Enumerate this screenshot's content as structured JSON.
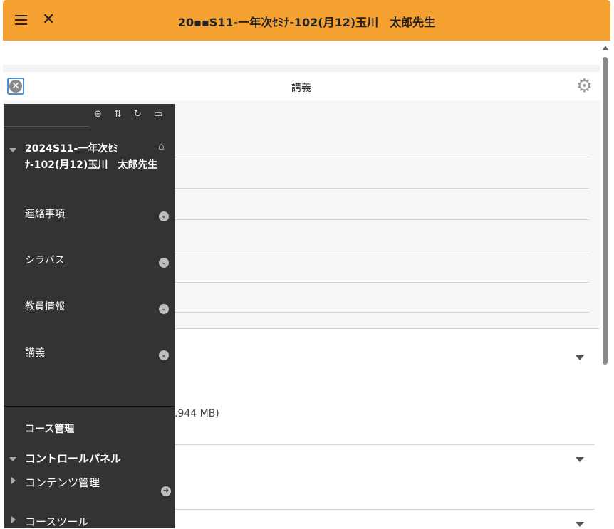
{
  "header": {
    "course_title": "20▪▪S11-一年次ｾﾐﾅ-102(月12)玉川　太郎先生",
    "menu_icon": "hamburger-icon",
    "close_icon": "close-icon",
    "color": "#f4a132"
  },
  "subbar": {
    "title": "講義",
    "close_icon": "close-circle-icon",
    "settings_icon": "gear-icon"
  },
  "content": {
    "file_size": ".944 MB)"
  },
  "panel": {
    "tools": [
      "add-icon",
      "sort-icon",
      "refresh-icon",
      "folder-icon"
    ],
    "course_name": "2024S11-一年次ｾﾐﾅ-102(月12)玉川　太郎先生",
    "items": [
      {
        "label": "連絡事項"
      },
      {
        "label": "シラバス"
      },
      {
        "label": "教員情報"
      },
      {
        "label": "講義"
      }
    ],
    "course_admin": "コース管理",
    "control_panel": "コントロールパネル",
    "content_mgmt": "コンテンツ管理",
    "course_tools": "コースツール",
    "bg_color": "#333333"
  }
}
